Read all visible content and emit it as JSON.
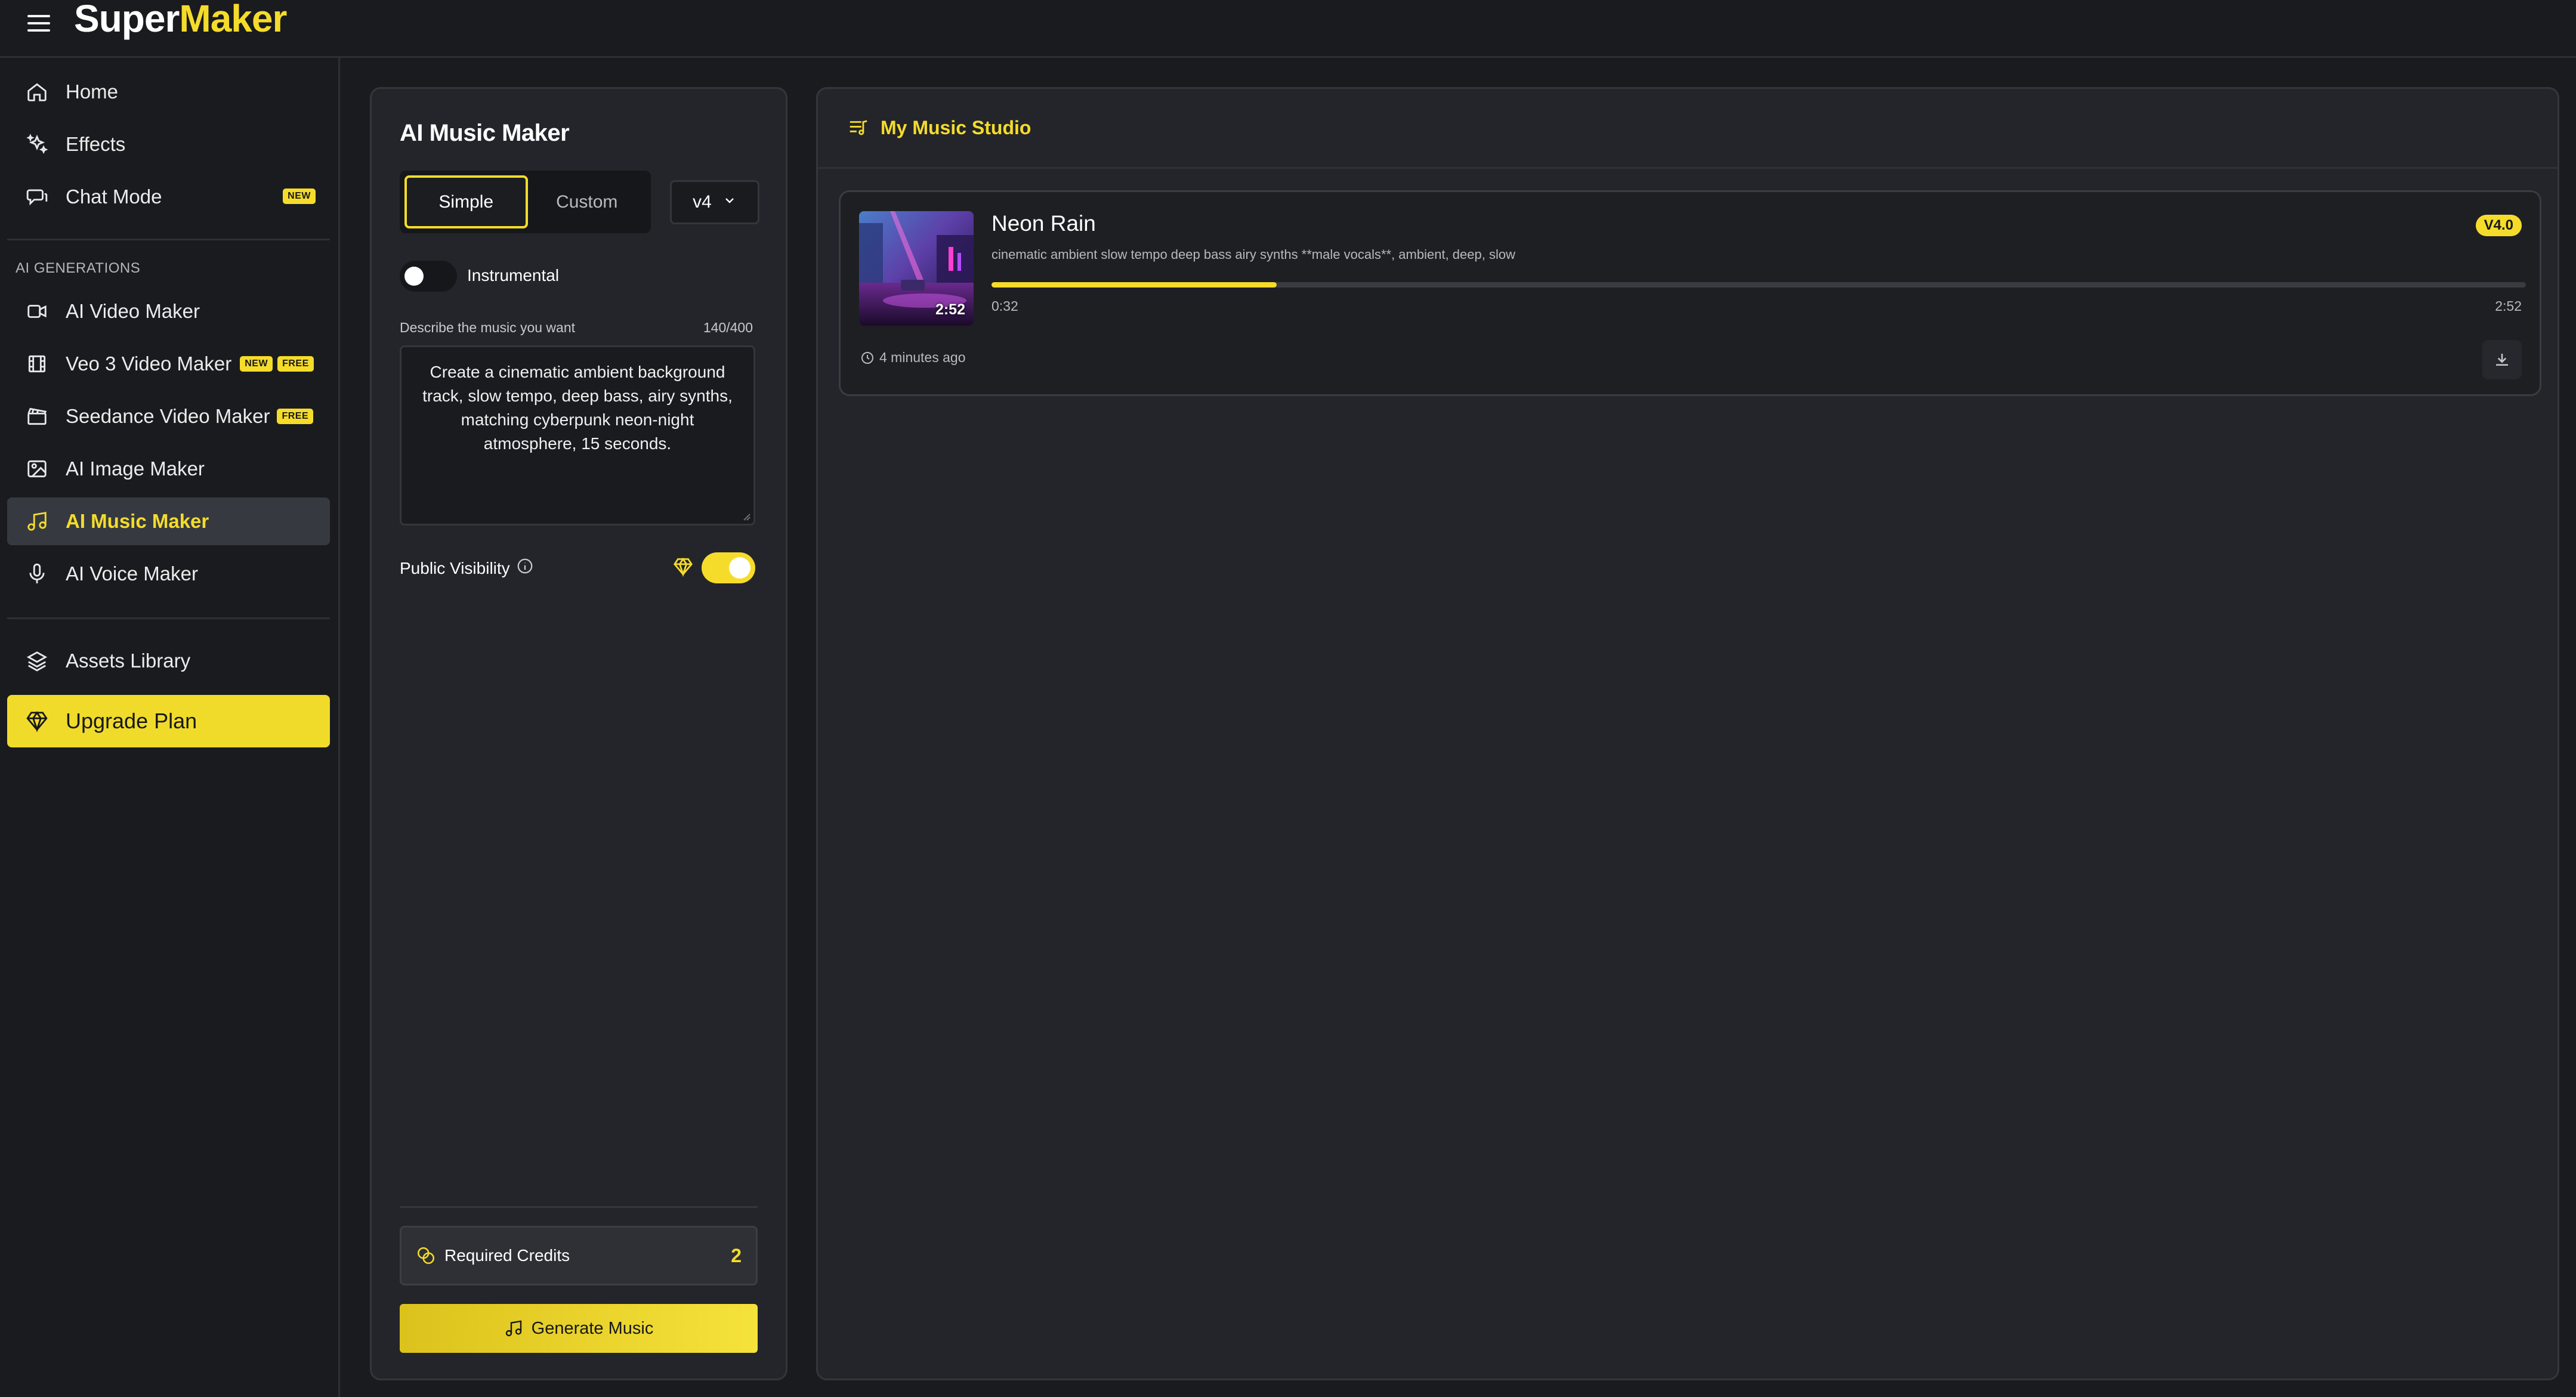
{
  "app": {
    "logo_part1": "Super",
    "logo_part2": "Maker",
    "accent_color": "#f5dc2a"
  },
  "sidebar": {
    "primary": [
      {
        "label": "Home",
        "icon": "home-icon"
      },
      {
        "label": "Effects",
        "icon": "sparkles-icon"
      },
      {
        "label": "Chat Mode",
        "icon": "chat-icon",
        "badge": "NEW"
      }
    ],
    "section_label": "AI GENERATIONS",
    "generations": [
      {
        "label": "AI Video Maker",
        "icon": "video-camera-icon"
      },
      {
        "label": "Veo 3 Video Maker",
        "icon": "film-icon",
        "badges": [
          "NEW",
          "FREE"
        ]
      },
      {
        "label": "Seedance Video Maker",
        "icon": "clapperboard-icon",
        "badge": "FREE"
      },
      {
        "label": "AI Image Maker",
        "icon": "image-icon"
      },
      {
        "label": "AI Music Maker",
        "icon": "music-note-icon",
        "active": true
      },
      {
        "label": "AI Voice Maker",
        "icon": "microphone-icon"
      }
    ],
    "assets": {
      "label": "Assets Library",
      "icon": "layers-icon"
    },
    "upgrade": {
      "label": "Upgrade Plan",
      "icon": "diamond-icon"
    }
  },
  "maker": {
    "title": "AI Music Maker",
    "modes": [
      "Simple",
      "Custom"
    ],
    "selected_mode": "Simple",
    "version": "v4",
    "instrumental_label": "Instrumental",
    "instrumental_on": false,
    "describe_label": "Describe the music you want",
    "char_count": "140/400",
    "prompt": "Create a cinematic ambient background track, slow tempo, deep bass, airy synths, matching cyberpunk neon-night atmosphere, 15 seconds.",
    "public_visibility_label": "Public Visibility",
    "public_visibility_on": true,
    "required_credits_label": "Required Credits",
    "required_credits": "2",
    "generate_label": "Generate Music"
  },
  "studio": {
    "title": "My Music Studio",
    "tracks": [
      {
        "title": "Neon Rain",
        "tags": "cinematic ambient slow tempo deep bass airy synths **male vocals**, ambient, deep, slow",
        "version": "V4.0",
        "duration": "2:52",
        "current_time": "0:32",
        "total_time": "2:52",
        "progress": 0.186,
        "created": "4 minutes ago"
      }
    ]
  }
}
